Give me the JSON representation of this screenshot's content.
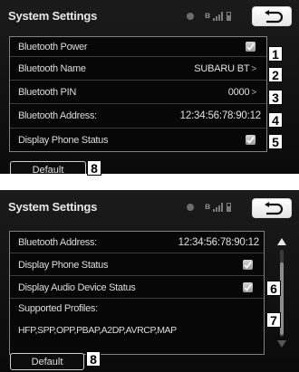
{
  "screen1": {
    "title": "System Settings",
    "status_icons": [
      "status-dot-icon",
      "bluetooth-icon",
      "signal-icon",
      "battery-icon"
    ],
    "back_icon": "back-arrow-icon",
    "rows": [
      {
        "label": "Bluetooth Power",
        "control": "checkbox",
        "checked": true,
        "callout": "1"
      },
      {
        "label": "Bluetooth Name",
        "value": "SUBARU BT",
        "chevron": ">",
        "callout": "2"
      },
      {
        "label": "Bluetooth PIN",
        "value": "0000",
        "chevron": ">",
        "callout": "3"
      },
      {
        "label": "Bluetooth Address:",
        "value": "12:34:56:78:90:12",
        "callout": "4"
      },
      {
        "label": "Display Phone Status",
        "control": "checkbox",
        "checked": true,
        "callout": "5"
      }
    ],
    "default_label": "Default",
    "default_callout": "8"
  },
  "screen2": {
    "title": "System Settings",
    "status_icons": [
      "status-dot-icon",
      "bluetooth-icon",
      "signal-icon",
      "battery-icon"
    ],
    "back_icon": "back-arrow-icon",
    "rows": [
      {
        "label": "Bluetooth Address:",
        "value": "12:34:56:78:90:12"
      },
      {
        "label": "Display Phone Status",
        "control": "checkbox",
        "checked": true
      },
      {
        "label": "Display Audio Device Status",
        "control": "checkbox",
        "checked": true,
        "callout": "6"
      },
      {
        "label": "Supported Profiles:",
        "value": "HFP,SPP,OPP,PBAP,A2DP,AVRCP,MAP",
        "callout": "7"
      }
    ],
    "default_label": "Default",
    "default_callout": "8"
  },
  "bluetooth_glyph": "ʙ"
}
